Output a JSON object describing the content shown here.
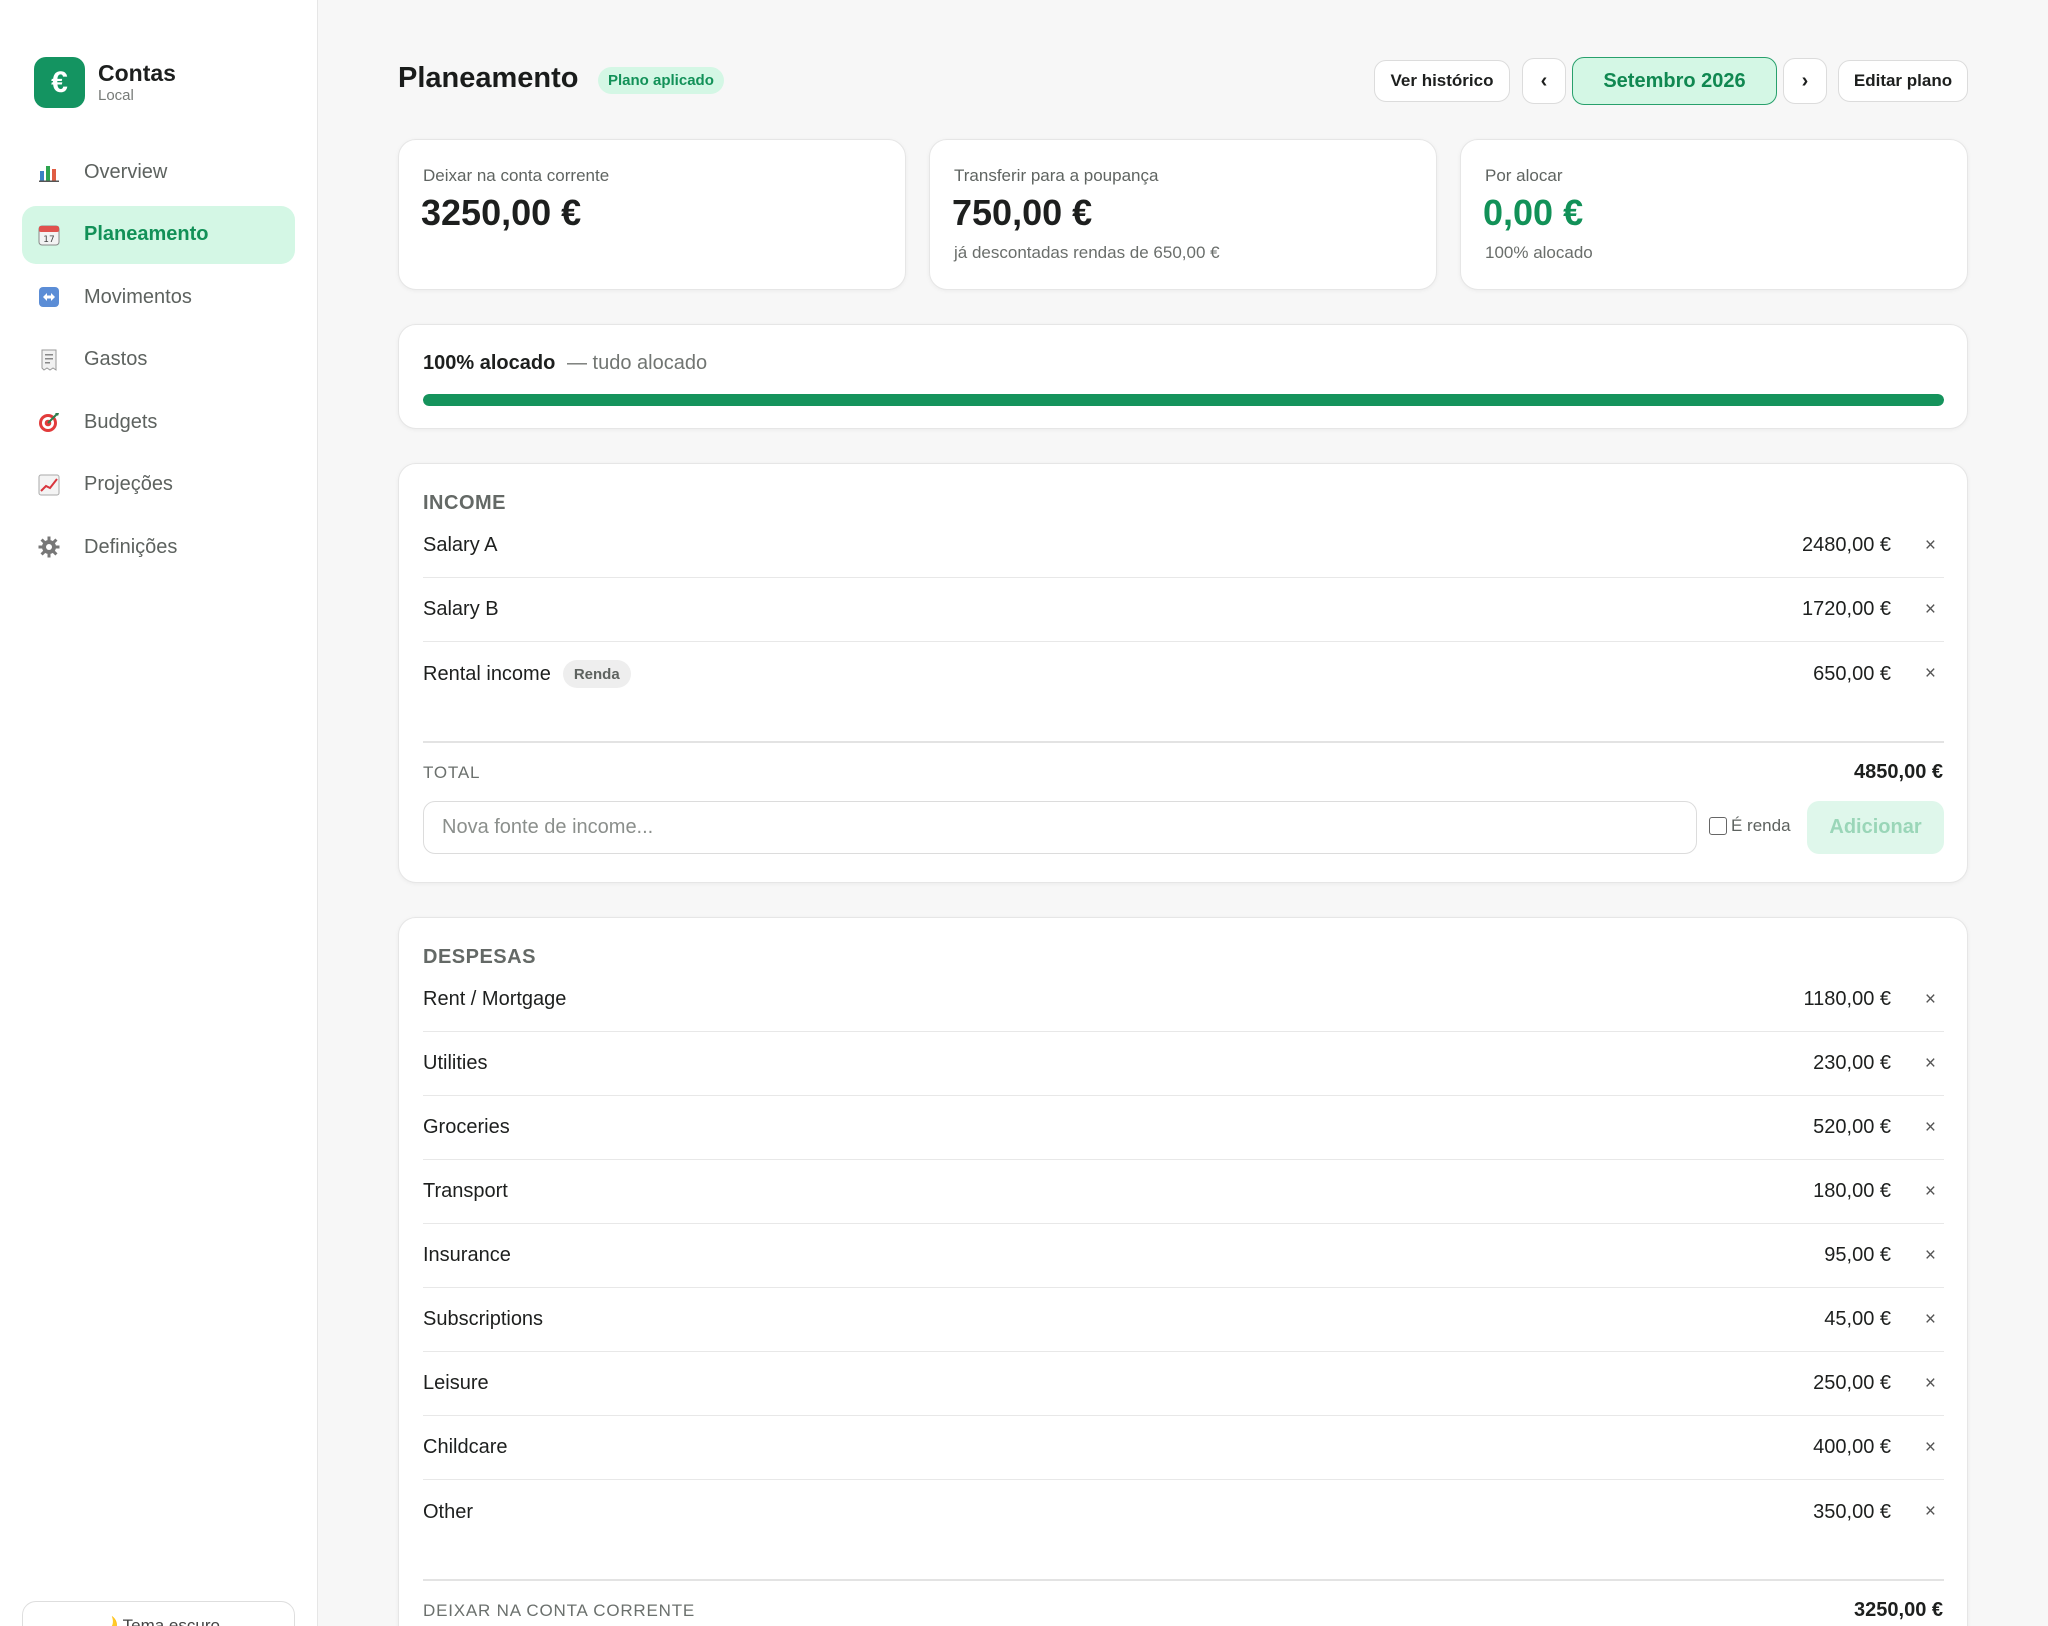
{
  "app": {
    "name": "Contas",
    "subtitle": "Local",
    "logo_symbol": "€"
  },
  "sidebar": {
    "items": [
      {
        "label": "Overview",
        "icon": "bar-chart-icon",
        "active": false
      },
      {
        "label": "Planeamento",
        "icon": "calendar-icon",
        "active": true
      },
      {
        "label": "Movimentos",
        "icon": "arrows-icon",
        "active": false
      },
      {
        "label": "Gastos",
        "icon": "receipt-icon",
        "active": false
      },
      {
        "label": "Budgets",
        "icon": "target-icon",
        "active": false
      },
      {
        "label": "Projeções",
        "icon": "trend-chart-icon",
        "active": false
      },
      {
        "label": "Definições",
        "icon": "gear-icon",
        "active": false
      }
    ],
    "theme_button": "🌙 Tema escuro"
  },
  "header": {
    "title": "Planeamento",
    "badge": "Plano aplicado",
    "history_button": "Ver histórico",
    "prev_label": "‹",
    "month": "Setembro 2026",
    "next_label": "›",
    "edit_button": "Editar plano"
  },
  "stats": [
    {
      "label": "Deixar na conta corrente",
      "value": "3250,00 €",
      "note": ""
    },
    {
      "label": "Transferir para a poupança",
      "value": "750,00 €",
      "note": "já descontadas rendas de 650,00 €"
    },
    {
      "label": "Por alocar",
      "value": "0,00 €",
      "note": "100% alocado"
    }
  ],
  "allocation": {
    "strong": "100% alocado",
    "rest": "— tudo alocado",
    "percent": 100
  },
  "income": {
    "title": "INCOME",
    "rows": [
      {
        "name": "Salary A",
        "tag": "",
        "amount": "2480,00 €"
      },
      {
        "name": "Salary B",
        "tag": "",
        "amount": "1720,00 €"
      },
      {
        "name": "Rental income",
        "tag": "Renda",
        "amount": "650,00 €"
      }
    ],
    "total_label": "TOTAL",
    "total_value": "4850,00 €",
    "input_placeholder": "Nova fonte de income...",
    "checkbox_label": "É renda",
    "add_button": "Adicionar"
  },
  "expenses": {
    "title": "DESPESAS",
    "rows": [
      {
        "name": "Rent / Mortgage",
        "amount": "1180,00 €"
      },
      {
        "name": "Utilities",
        "amount": "230,00 €"
      },
      {
        "name": "Groceries",
        "amount": "520,00 €"
      },
      {
        "name": "Transport",
        "amount": "180,00 €"
      },
      {
        "name": "Insurance",
        "amount": "95,00 €"
      },
      {
        "name": "Subscriptions",
        "amount": "45,00 €"
      },
      {
        "name": "Leisure",
        "amount": "250,00 €"
      },
      {
        "name": "Childcare",
        "amount": "400,00 €"
      },
      {
        "name": "Other",
        "amount": "350,00 €"
      }
    ],
    "footer_label": "DEIXAR NA CONTA CORRENTE",
    "footer_value": "3250,00 €"
  },
  "remove_symbol": "×",
  "colors": {
    "accent": "#149461",
    "accent_light": "#d4f7e5",
    "background": "#f7f7f7"
  }
}
